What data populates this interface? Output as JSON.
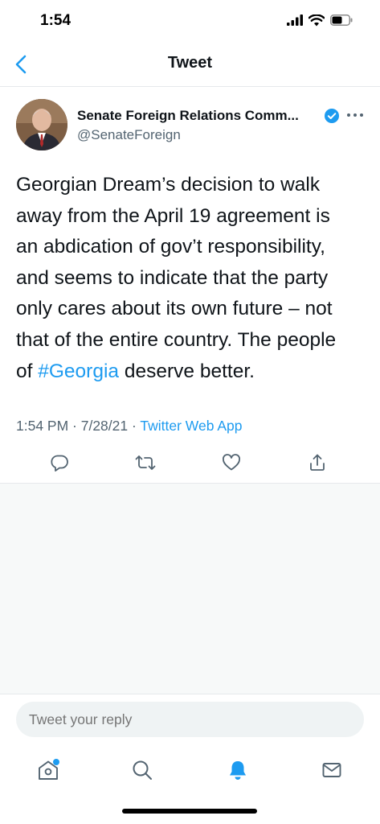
{
  "status_bar": {
    "time": "1:54"
  },
  "nav": {
    "title": "Tweet"
  },
  "tweet": {
    "author_name": "Senate Foreign Relations Comm...",
    "author_handle": "@SenateForeign",
    "body_lines": [
      "Georgian Dream’s decision to walk",
      "away from the April 19 agreement is",
      "an abdication of gov’t responsibility,",
      "and seems to indicate that the party",
      "only cares about its own future – not",
      "that of the entire country. The people"
    ],
    "last_line_prefix": "of ",
    "hashtag": "#Georgia",
    "last_line_suffix": " deserve better.",
    "timestamp": "1:54 PM · 7/28/21 · ",
    "source": "Twitter Web App"
  },
  "reply": {
    "placeholder": "Tweet your reply"
  },
  "colors": {
    "accent": "#1d9bf0",
    "text": "#0f1419",
    "secondary": "#536471",
    "background": "#f7f9f9"
  },
  "icons": {
    "back": "chevron-left-icon",
    "verified": "verified-badge-icon",
    "more": "more-horizontal-icon",
    "reply": "reply-icon",
    "retweet": "retweet-icon",
    "like": "heart-icon",
    "share": "share-icon",
    "home": "home-icon",
    "search": "search-icon",
    "notifications": "bell-icon",
    "messages": "mail-icon"
  }
}
